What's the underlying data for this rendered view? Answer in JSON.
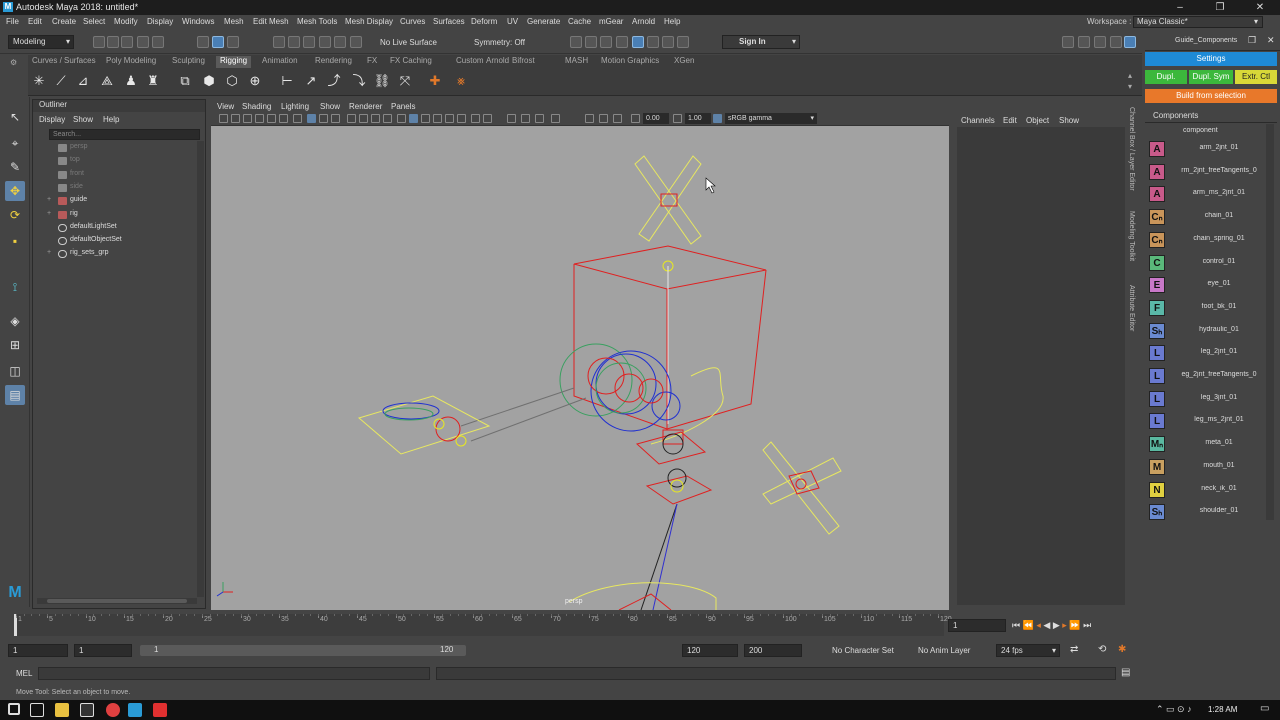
{
  "window": {
    "title": "Autodesk Maya 2018: untitled*"
  },
  "menu": [
    "File",
    "Edit",
    "Create",
    "Select",
    "Modify",
    "Display",
    "Windows",
    "Mesh",
    "Edit Mesh",
    "Mesh Tools",
    "Mesh Display",
    "Curves",
    "Surfaces",
    "Deform",
    "UV",
    "Generate",
    "Cache",
    "mGear",
    "Arnold",
    "Help"
  ],
  "workspace": {
    "label": "Workspace :",
    "value": "Maya Classic*"
  },
  "status": {
    "mode": "Modeling",
    "live_surface": "No Live Surface",
    "symmetry": "Symmetry: Off",
    "sign_in": "Sign In"
  },
  "shelf_tabs": [
    "Curves / Surfaces",
    "Poly Modeling",
    "Sculpting",
    "Rigging",
    "Animation",
    "Rendering",
    "FX",
    "FX Caching",
    "Custom",
    "Arnold",
    "Bifrost",
    "MASH",
    "Motion Graphics",
    "XGen"
  ],
  "shelf_active": "Rigging",
  "outliner": {
    "title": "Outliner",
    "menu": [
      "Display",
      "Show",
      "Help"
    ],
    "search_placeholder": "Search...",
    "items": [
      {
        "label": "persp",
        "dim": true,
        "expand": ""
      },
      {
        "label": "top",
        "dim": true,
        "expand": ""
      },
      {
        "label": "front",
        "dim": true,
        "expand": ""
      },
      {
        "label": "side",
        "dim": true,
        "expand": ""
      },
      {
        "label": "guide",
        "dim": false,
        "expand": "+"
      },
      {
        "label": "rig",
        "dim": false,
        "expand": "+"
      },
      {
        "label": "defaultLightSet",
        "dim": false,
        "expand": ""
      },
      {
        "label": "defaultObjectSet",
        "dim": false,
        "expand": ""
      },
      {
        "label": "rig_sets_grp",
        "dim": false,
        "expand": "+"
      }
    ]
  },
  "viewport": {
    "menu": [
      "View",
      "Shading",
      "Lighting",
      "Show",
      "Renderer",
      "Panels"
    ],
    "field_a": "0.00",
    "field_b": "1.00",
    "colorspace": "sRGB gamma",
    "camera_label": "persp"
  },
  "channel_box": {
    "menu": [
      "Channels",
      "Edit",
      "Object",
      "Show"
    ]
  },
  "side_tabs": [
    "Channel Box / Layer Editor",
    "Modeling Toolkit",
    "Attribute Editor"
  ],
  "guide_panel": {
    "title": "Guide_Components",
    "settings": "Settings",
    "dupl": "Dupl.",
    "dupl_sym": "Dupl. Sym",
    "extr_ctl": "Extr. Ctl",
    "build": "Build from selection",
    "components_label": "Components",
    "list_header": "component",
    "items": [
      {
        "letter": "A",
        "name": "arm_2jnt_01",
        "color": "#c85a8a"
      },
      {
        "letter": "A",
        "name": "rm_2jnt_freeTangents_0",
        "color": "#c85a8a"
      },
      {
        "letter": "A",
        "name": "arm_ms_2jnt_01",
        "color": "#c85a8a"
      },
      {
        "letter": "Cₙ",
        "name": "chain_01",
        "color": "#c9955a"
      },
      {
        "letter": "Cₙ",
        "name": "chain_spring_01",
        "color": "#c9955a"
      },
      {
        "letter": "C",
        "name": "control_01",
        "color": "#5ab87a"
      },
      {
        "letter": "E",
        "name": "eye_01",
        "color": "#c878c8"
      },
      {
        "letter": "F",
        "name": "foot_bk_01",
        "color": "#5ab8a8"
      },
      {
        "letter": "Sₕ",
        "name": "hydraulic_01",
        "color": "#6a8ad0"
      },
      {
        "letter": "L",
        "name": "leg_2jnt_01",
        "color": "#6a7ad0"
      },
      {
        "letter": "L",
        "name": "eg_2jnt_freeTangents_0",
        "color": "#6a7ad0"
      },
      {
        "letter": "L",
        "name": "leg_3jnt_01",
        "color": "#6a7ad0"
      },
      {
        "letter": "L",
        "name": "leg_ms_2jnt_01",
        "color": "#6a7ad0"
      },
      {
        "letter": "Mₙ",
        "name": "meta_01",
        "color": "#5ab8a0"
      },
      {
        "letter": "M",
        "name": "mouth_01",
        "color": "#c9a060"
      },
      {
        "letter": "N",
        "name": "neck_ik_01",
        "color": "#e0d040"
      },
      {
        "letter": "Sₕ",
        "name": "shoulder_01",
        "color": "#6a8ad0"
      }
    ]
  },
  "timeline": {
    "ticks": [
      "1",
      "5",
      "10",
      "15",
      "20",
      "25",
      "30",
      "35",
      "40",
      "45",
      "50",
      "55",
      "60",
      "65",
      "70",
      "75",
      "80",
      "85",
      "90",
      "95",
      "100",
      "105",
      "110",
      "115",
      "120"
    ],
    "current_frame": "1"
  },
  "range": {
    "start": "1",
    "inner_start": "1",
    "slider_start": "1",
    "slider_end": "120",
    "inner_end": "120",
    "end": "200",
    "character_set": "No Character Set",
    "anim_layer": "No Anim Layer",
    "fps": "24 fps"
  },
  "command_line": {
    "label": "MEL"
  },
  "help_line": "Move Tool: Select an object to move.",
  "taskbar": {
    "time": "1:28 AM"
  }
}
